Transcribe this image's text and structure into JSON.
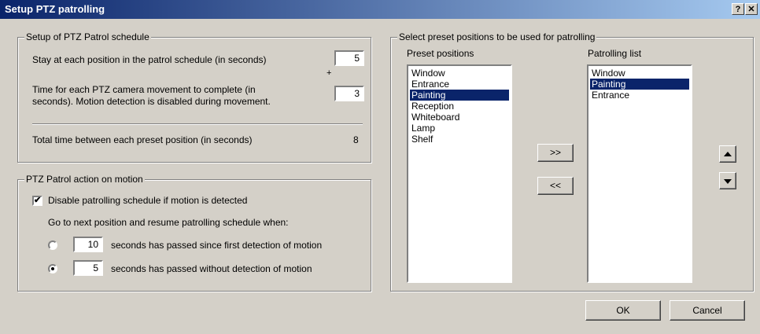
{
  "window": {
    "title": "Setup PTZ patrolling",
    "help_glyph": "?",
    "close_glyph": "✕"
  },
  "schedule": {
    "legend": "Setup of PTZ Patrol schedule",
    "stay_label": "Stay at each position in the patrol schedule (in seconds)",
    "stay_value": "5",
    "plus": "+",
    "movement_label_line1": "Time for each PTZ camera movement to complete (in",
    "movement_label_line2": "seconds). Motion detection is disabled during movement.",
    "movement_value": "3",
    "total_label": "Total time between each preset position (in seconds)",
    "total_value": "8"
  },
  "motion": {
    "legend": "PTZ Patrol action on motion",
    "disable_label": "Disable patrolling schedule if motion is detected",
    "disable_checked": "✔",
    "resume_label": "Go to next position and resume patrolling schedule when:",
    "option1_value": "10",
    "option1_label": "seconds has passed since first detection of motion",
    "option2_value": "5",
    "option2_label": "seconds has passed without detection of motion"
  },
  "presets": {
    "legend": "Select preset positions to be used for patrolling",
    "preset_header": "Preset positions",
    "patrol_header": "Patrolling list",
    "preset_items": [
      "Window",
      "Entrance",
      "Painting",
      "Reception",
      "Whiteboard",
      "Lamp",
      "Shelf"
    ],
    "preset_selected_index": 2,
    "patrol_items": [
      "Window",
      "Painting",
      "Entrance"
    ],
    "patrol_selected_index": 1,
    "add_label": ">>",
    "remove_label": "<<"
  },
  "buttons": {
    "ok": "OK",
    "cancel": "Cancel"
  },
  "colors": {
    "selection": "#0a246a",
    "face": "#d4d0c8"
  }
}
